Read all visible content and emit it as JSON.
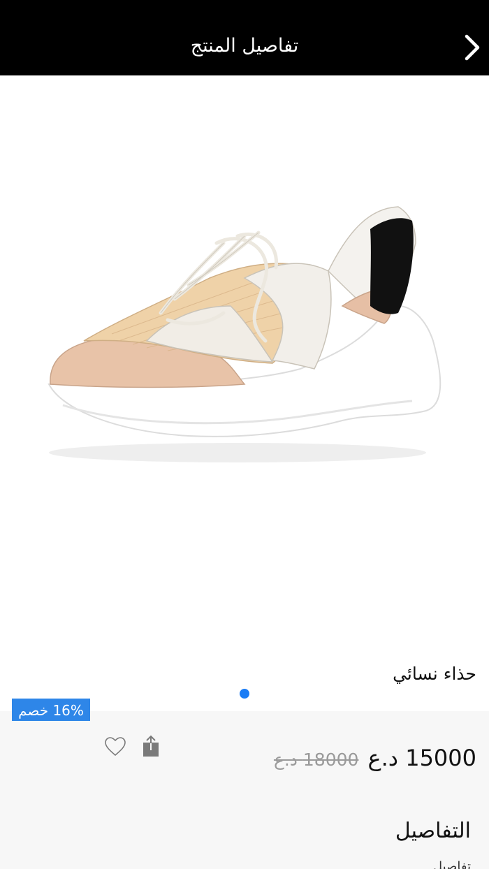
{
  "header": {
    "title": "تفاصيل المنتج",
    "back_icon": "chevron-right-icon"
  },
  "gallery": {
    "image_name": "womens-sneaker-image",
    "dot_color": "#1a7cf5",
    "page_count": 1,
    "active_page": 1
  },
  "product": {
    "name": "حذاء نسائي",
    "discount_badge": "16% خصم",
    "price_current": "15000 د.ع",
    "price_old": "18000 د.ع",
    "accent_color": "#2e86e8"
  },
  "actions": {
    "favorite_icon": "heart-icon",
    "share_icon": "share-icon"
  },
  "details": {
    "heading": "التفاصيل",
    "sub": "تفاصيل"
  }
}
